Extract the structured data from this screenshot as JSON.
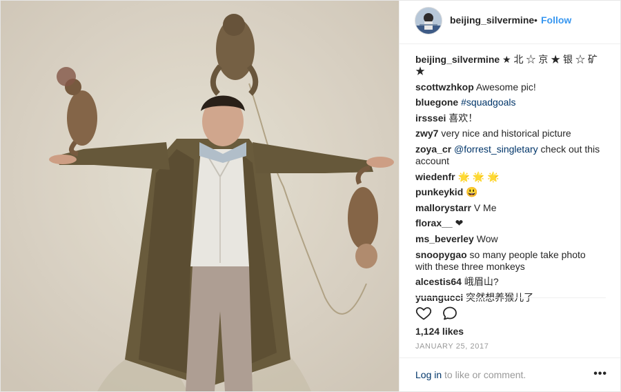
{
  "post": {
    "username": "beijing_silvermine",
    "dot": "•",
    "follow_label": "Follow",
    "likes": "1,124 likes",
    "date": "JANUARY 25, 2017"
  },
  "comments": [
    {
      "user": "beijing_silvermine",
      "text": " ★ 北 ☆ 京 ★ 银 ☆ 矿 ★"
    },
    {
      "user": "scottwzhkop",
      "text": " Awesome pic!"
    },
    {
      "user": "bluegone",
      "text": " ",
      "tag": "#squadgoals"
    },
    {
      "user": "irsssei",
      "text": " 喜欢！"
    },
    {
      "user": "zwy7",
      "text": " very nice and historical picture"
    },
    {
      "user": "zoya_cr",
      "text": " check out this account",
      "tag": "@forrest_singletary"
    },
    {
      "user": "wiedenfr",
      "text": " 🌟 🌟 🌟"
    },
    {
      "user": "punkeykid",
      "text": " 😃"
    },
    {
      "user": "mallorystarr",
      "text": " V Me"
    },
    {
      "user": "florax__",
      "text": " ❤"
    },
    {
      "user": "ms_beverley",
      "text": " Wow"
    },
    {
      "user": "snoopygao",
      "text": " so many people take photo with these three monkeys"
    },
    {
      "user": "alcestis64",
      "text": " 峨眉山?"
    },
    {
      "user": "yuangucci",
      "text": " 突然想养猴儿了"
    }
  ],
  "footer": {
    "login_label": "Log in",
    "login_suffix": " to like or comment.",
    "more_label": "•••"
  },
  "icons": {
    "like": "heart-outline-icon",
    "comment": "speech-bubble-icon",
    "more": "ellipsis-icon"
  },
  "colors": {
    "follow": "#3897f0",
    "link": "#003569",
    "muted": "#999999"
  }
}
